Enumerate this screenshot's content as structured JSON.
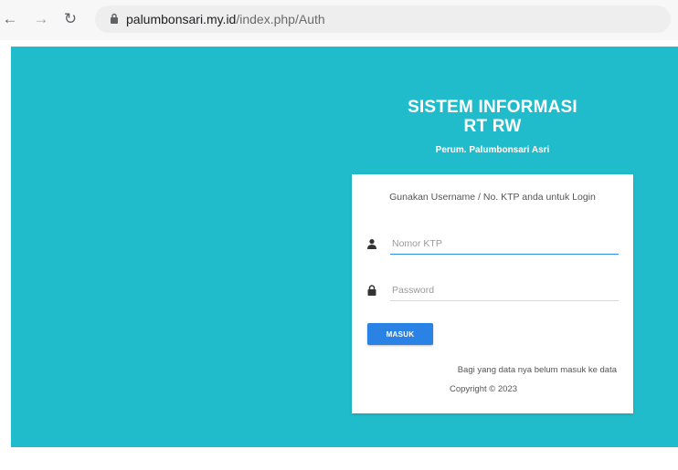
{
  "browser": {
    "back_icon": "back-arrow-icon",
    "forward_icon": "forward-arrow-icon",
    "reload_icon": "reload-icon",
    "url_domain": "palumbonsari.my.id",
    "url_path": "/index.php/Auth"
  },
  "header": {
    "title_line1": "SISTEM INFORMASI",
    "title_line2": "RT RW",
    "subtitle": "Perum. Palumbonsari Asri"
  },
  "login": {
    "hint": "Gunakan Username / No. KTP anda untuk Login",
    "username_placeholder": "Nomor KTP",
    "username_value": "",
    "password_placeholder": "Password",
    "password_value": "",
    "submit_label": "MASUK",
    "note": "Bagi yang data nya belum masuk ke data",
    "copyright": "Copyright © 2023"
  },
  "colors": {
    "background": "#21bccb",
    "button": "#2a82e4",
    "active_underline": "#2d8fe0"
  }
}
